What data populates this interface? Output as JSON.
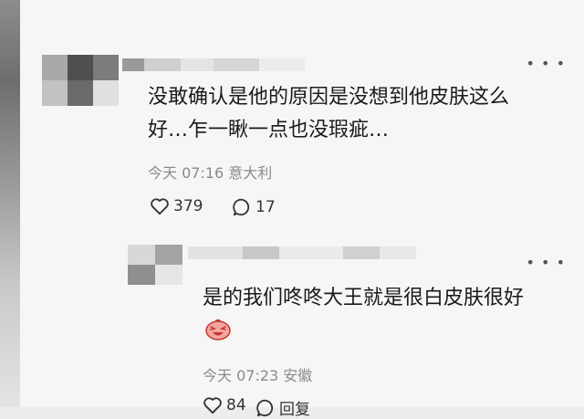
{
  "comment1": {
    "text_line1": "没敢确认是他的原因是没想到他皮肤这么",
    "text_line2": "好…乍一瞅一点也没瑕疵…",
    "meta": "今天 07:16 意大利",
    "likes": "379",
    "replies": "17",
    "more_icon": "more-dots-icon"
  },
  "reply1": {
    "text": "是的我们咚咚大王就是很白皮肤很好",
    "meta": "今天 07:23 安徽",
    "likes": "84",
    "replies": "回复",
    "emoji_icon": "laughing-face-emoji-icon"
  },
  "colors": {
    "background": "#f6f6f6",
    "text": "#1a1a1a",
    "meta": "#8a8a8a"
  }
}
